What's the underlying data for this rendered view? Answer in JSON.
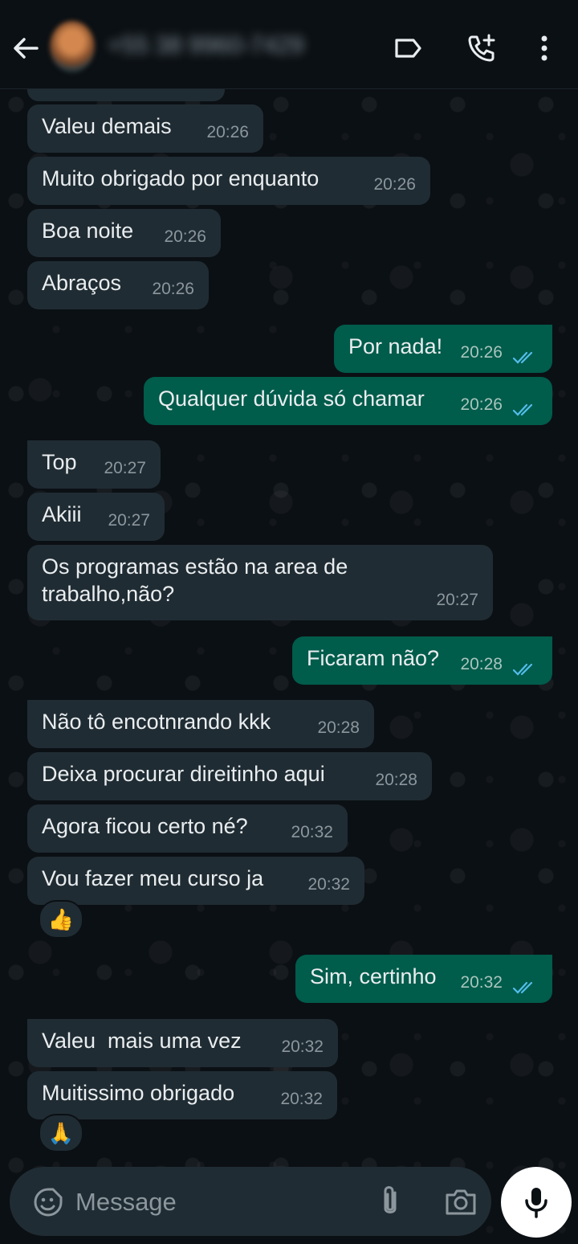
{
  "header": {
    "contact_name": "+55 38 9960-7429",
    "back_icon": "arrow-left-icon",
    "label_icon": "label-icon",
    "call_icon": "add-call-icon",
    "menu_icon": "more-vert-icon"
  },
  "messages": [
    {
      "direction": "in",
      "text": "Valeu demais",
      "time": "20:26"
    },
    {
      "direction": "in",
      "text": "Muito obrigado por enquanto",
      "time": "20:26"
    },
    {
      "direction": "in",
      "text": "Boa noite",
      "time": "20:26"
    },
    {
      "direction": "in",
      "text": "Abraços",
      "time": "20:26"
    },
    {
      "direction": "out",
      "text": "Por nada!",
      "time": "20:26",
      "status": "read"
    },
    {
      "direction": "out",
      "text": "Qualquer dúvida só chamar",
      "time": "20:26",
      "status": "read"
    },
    {
      "direction": "in",
      "text": "Top",
      "time": "20:27"
    },
    {
      "direction": "in",
      "text": "Akiii",
      "time": "20:27"
    },
    {
      "direction": "in",
      "text": "Os programas estão na area de",
      "text2": "trabalho,não?",
      "time": "20:27"
    },
    {
      "direction": "out",
      "text": "Ficaram não?",
      "time": "20:28",
      "status": "read"
    },
    {
      "direction": "in",
      "text": "Não tô encotnrando kkk",
      "time": "20:28"
    },
    {
      "direction": "in",
      "text": "Deixa procurar direitinho aqui",
      "time": "20:28"
    },
    {
      "direction": "in",
      "text": "Agora ficou certo né?",
      "time": "20:32"
    },
    {
      "direction": "in",
      "text": "Vou fazer meu curso ja",
      "time": "20:32",
      "reaction": "👍"
    },
    {
      "direction": "out",
      "text": "Sim, certinho",
      "time": "20:32",
      "status": "read"
    },
    {
      "direction": "in",
      "text": "Valeu  mais uma vez",
      "time": "20:32"
    },
    {
      "direction": "in",
      "text": "Muitissimo obrigado",
      "time": "20:32",
      "reaction": "🙏"
    }
  ],
  "composer": {
    "placeholder": "Message",
    "emoji_icon": "emoji-icon",
    "attach_icon": "paperclip-icon",
    "camera_icon": "camera-icon",
    "mic_icon": "microphone-icon"
  },
  "colors": {
    "background": "#0b1014",
    "incoming_bubble": "#202c33",
    "outgoing_bubble": "#005c4b",
    "read_ticks": "#53bdeb"
  }
}
